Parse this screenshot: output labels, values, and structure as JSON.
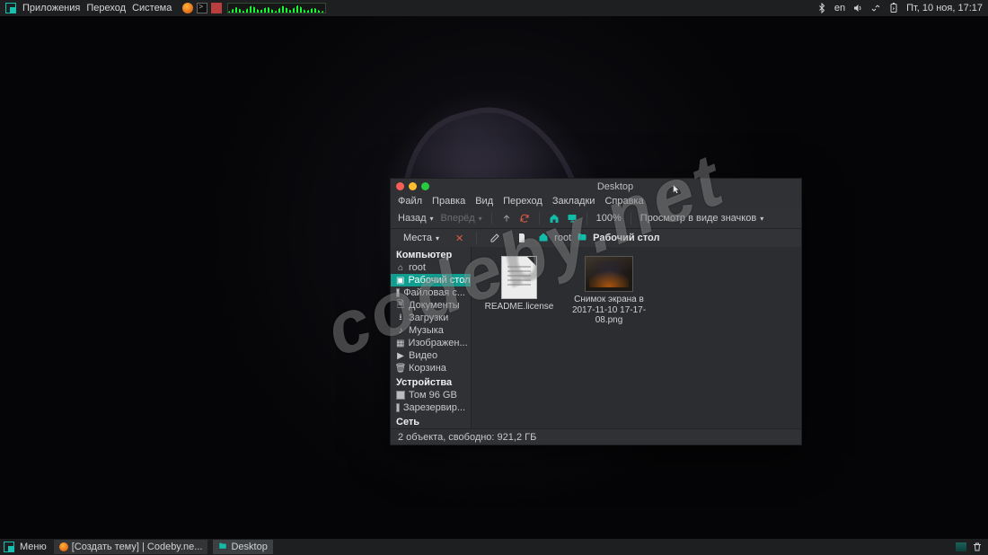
{
  "top": {
    "apps": "Приложения",
    "go": "Переход",
    "system": "Система",
    "lang": "en",
    "clock": "Пт, 10 ноя, 17:17"
  },
  "bottom": {
    "menu": "Меню",
    "task1": "[Создать тему] | Codeby.ne...",
    "task2": "Desktop"
  },
  "fm": {
    "title": "Desktop",
    "menu": {
      "file": "Файл",
      "edit": "Правка",
      "view": "Вид",
      "go": "Переход",
      "bookmarks": "Закладки",
      "help": "Справка"
    },
    "tb": {
      "back": "Назад",
      "fwd": "Вперёд",
      "zoom": "100%",
      "viewmode": "Просмотр в виде значков"
    },
    "loc": {
      "places": "Места",
      "root": "root",
      "desktop": "Рабочий стол"
    },
    "side": {
      "computer": "Компьютер",
      "items_comp": [
        "root",
        "Рабочий стол",
        "Файловая с...",
        "Документы",
        "Загрузки",
        "Музыка",
        "Изображен...",
        "Видео",
        "Корзина"
      ],
      "devices": "Устройства",
      "items_dev": [
        "Том 96 GB",
        "Зарезервир..."
      ],
      "network": "Сеть"
    },
    "files": {
      "f1": "README.license",
      "f2": "Снимок экрана в 2017-11-10 17-17-08.png"
    },
    "status": "2 объекта, свободно: 921,2 ГБ"
  },
  "watermark": "codeby.net"
}
